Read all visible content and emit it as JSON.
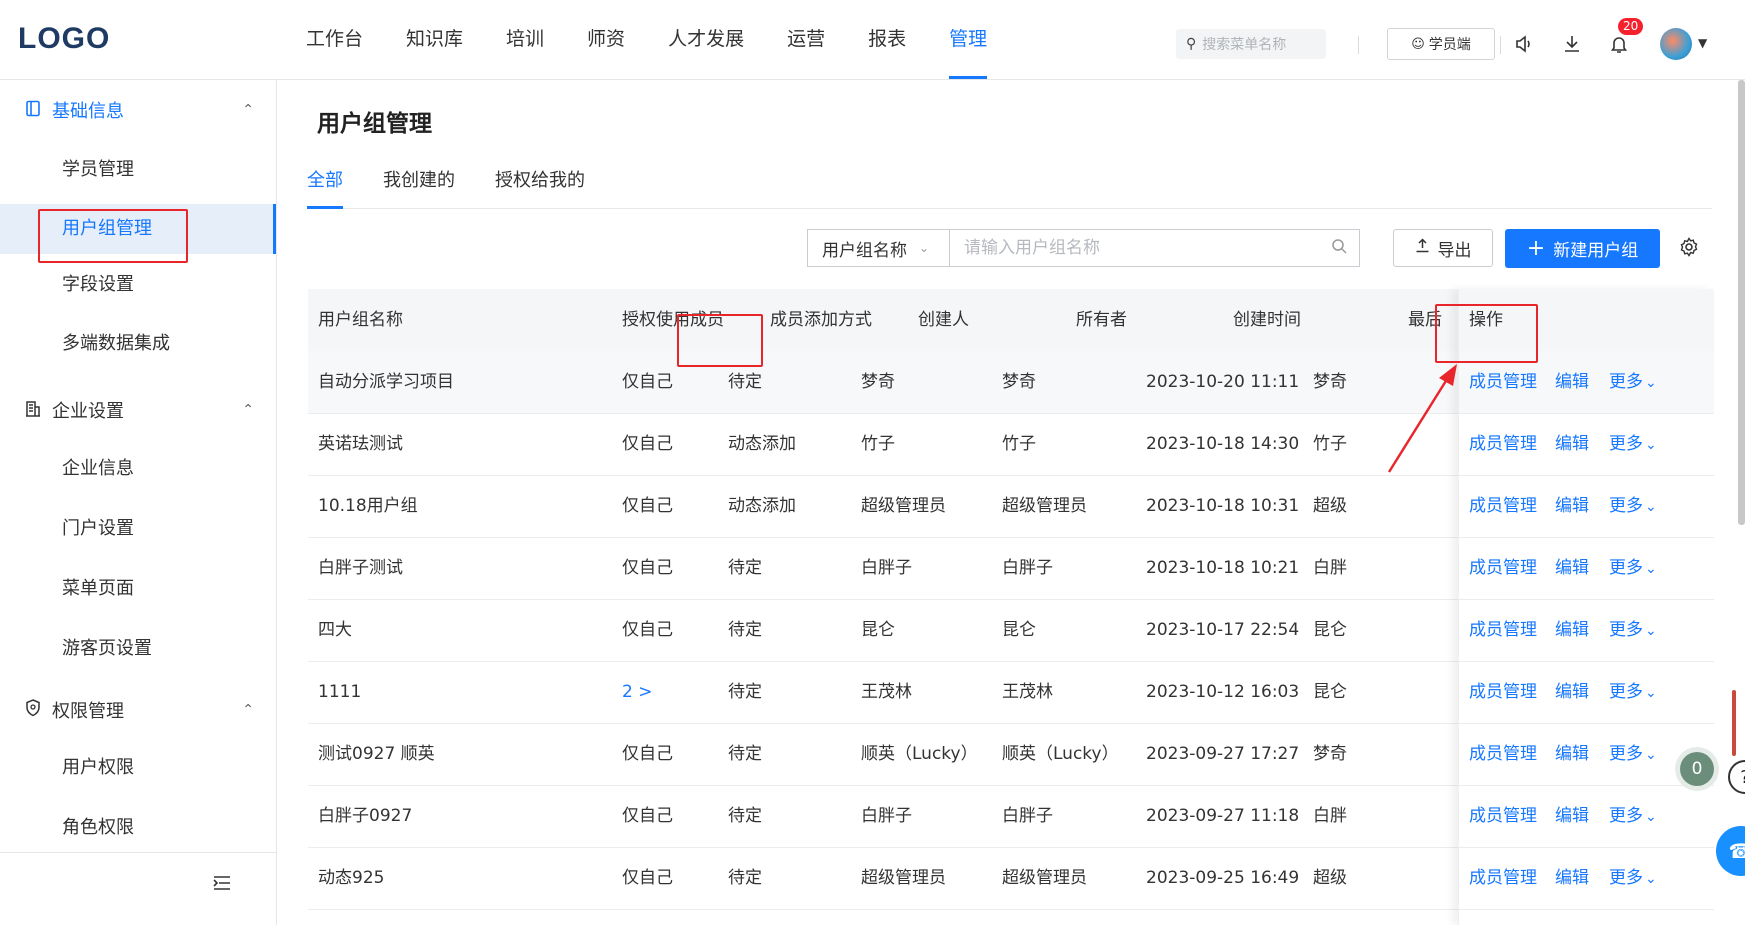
{
  "logo": "LOGO",
  "nav": [
    {
      "label": "工作台",
      "active": false
    },
    {
      "label": "知识库",
      "active": false
    },
    {
      "label": "培训",
      "active": false
    },
    {
      "label": "师资",
      "active": false
    },
    {
      "label": "人才发展",
      "active": false
    },
    {
      "label": "运营",
      "active": false
    },
    {
      "label": "报表",
      "active": false
    },
    {
      "label": "管理",
      "active": true
    }
  ],
  "header": {
    "search_placeholder": "搜索菜单名称",
    "student_label": "学员端",
    "notification_count": "20"
  },
  "sidebar": {
    "groups": [
      {
        "label": "基础信息",
        "icon": "book-icon",
        "active": true,
        "items": [
          "学员管理",
          "用户组管理",
          "字段设置",
          "多端数据集成"
        ]
      },
      {
        "label": "企业设置",
        "icon": "building-icon",
        "active": false,
        "items": [
          "企业信息",
          "门户设置",
          "菜单页面",
          "游客页设置"
        ]
      },
      {
        "label": "权限管理",
        "icon": "shield-icon",
        "active": false,
        "items": [
          "用户权限",
          "角色权限"
        ]
      }
    ],
    "selected_item": "用户组管理"
  },
  "page": {
    "title": "用户组管理",
    "tabs": [
      {
        "label": "全部",
        "active": true
      },
      {
        "label": "我创建的",
        "active": false
      },
      {
        "label": "授权给我的",
        "active": false
      }
    ],
    "filter_select": "用户组名称",
    "filter_placeholder": "请输入用户组名称",
    "export_label": "导出",
    "new_label": "新建用户组"
  },
  "table": {
    "columns": [
      "用户组名称",
      "授权使用成员",
      "成员添加方式",
      "创建人",
      "所有者",
      "创建时间",
      "最后",
      "操作"
    ],
    "actions": {
      "members": "成员管理",
      "edit": "编辑",
      "more": "更多"
    },
    "rows": [
      {
        "name": "自动分派学习项目",
        "auth": "仅自己",
        "add": "待定",
        "creator": "梦奇",
        "owner": "梦奇",
        "time": "2023-10-20 11:11",
        "last": "梦奇"
      },
      {
        "name": "英诺珐测试",
        "auth": "仅自己",
        "add": "动态添加",
        "creator": "竹子",
        "owner": "竹子",
        "time": "2023-10-18 14:30",
        "last": "竹子"
      },
      {
        "name": "10.18用户组",
        "auth": "仅自己",
        "add": "动态添加",
        "creator": "超级管理员",
        "owner": "超级管理员",
        "time": "2023-10-18 10:31",
        "last": "超级"
      },
      {
        "name": "白胖子测试",
        "auth": "仅自己",
        "add": "待定",
        "creator": "白胖子",
        "owner": "白胖子",
        "time": "2023-10-18 10:21",
        "last": "白胖"
      },
      {
        "name": "四大",
        "auth": "仅自己",
        "add": "待定",
        "creator": "昆仑",
        "owner": "昆仑",
        "time": "2023-10-17 22:54",
        "last": "昆仑"
      },
      {
        "name": "1111",
        "auth": "2 >",
        "add": "待定",
        "creator": "王茂林",
        "owner": "王茂林",
        "time": "2023-10-12 16:03",
        "last": "昆仑"
      },
      {
        "name": "测试0927 顺英",
        "auth": "仅自己",
        "add": "待定",
        "creator": "顺英（Lucky）",
        "owner": "顺英（Lucky）",
        "time": "2023-09-27 17:27",
        "last": "梦奇"
      },
      {
        "name": "白胖子0927",
        "auth": "仅自己",
        "add": "待定",
        "creator": "白胖子",
        "owner": "白胖子",
        "time": "2023-09-27 11:18",
        "last": "白胖"
      },
      {
        "name": "动态925",
        "auth": "仅自己",
        "add": "待定",
        "creator": "超级管理员",
        "owner": "超级管理员",
        "time": "2023-09-25 16:49",
        "last": "超级"
      }
    ]
  },
  "float": {
    "badge": "0",
    "help": "?"
  },
  "colors": {
    "accent": "#1677ff",
    "highlight_box": "#e8252a"
  }
}
